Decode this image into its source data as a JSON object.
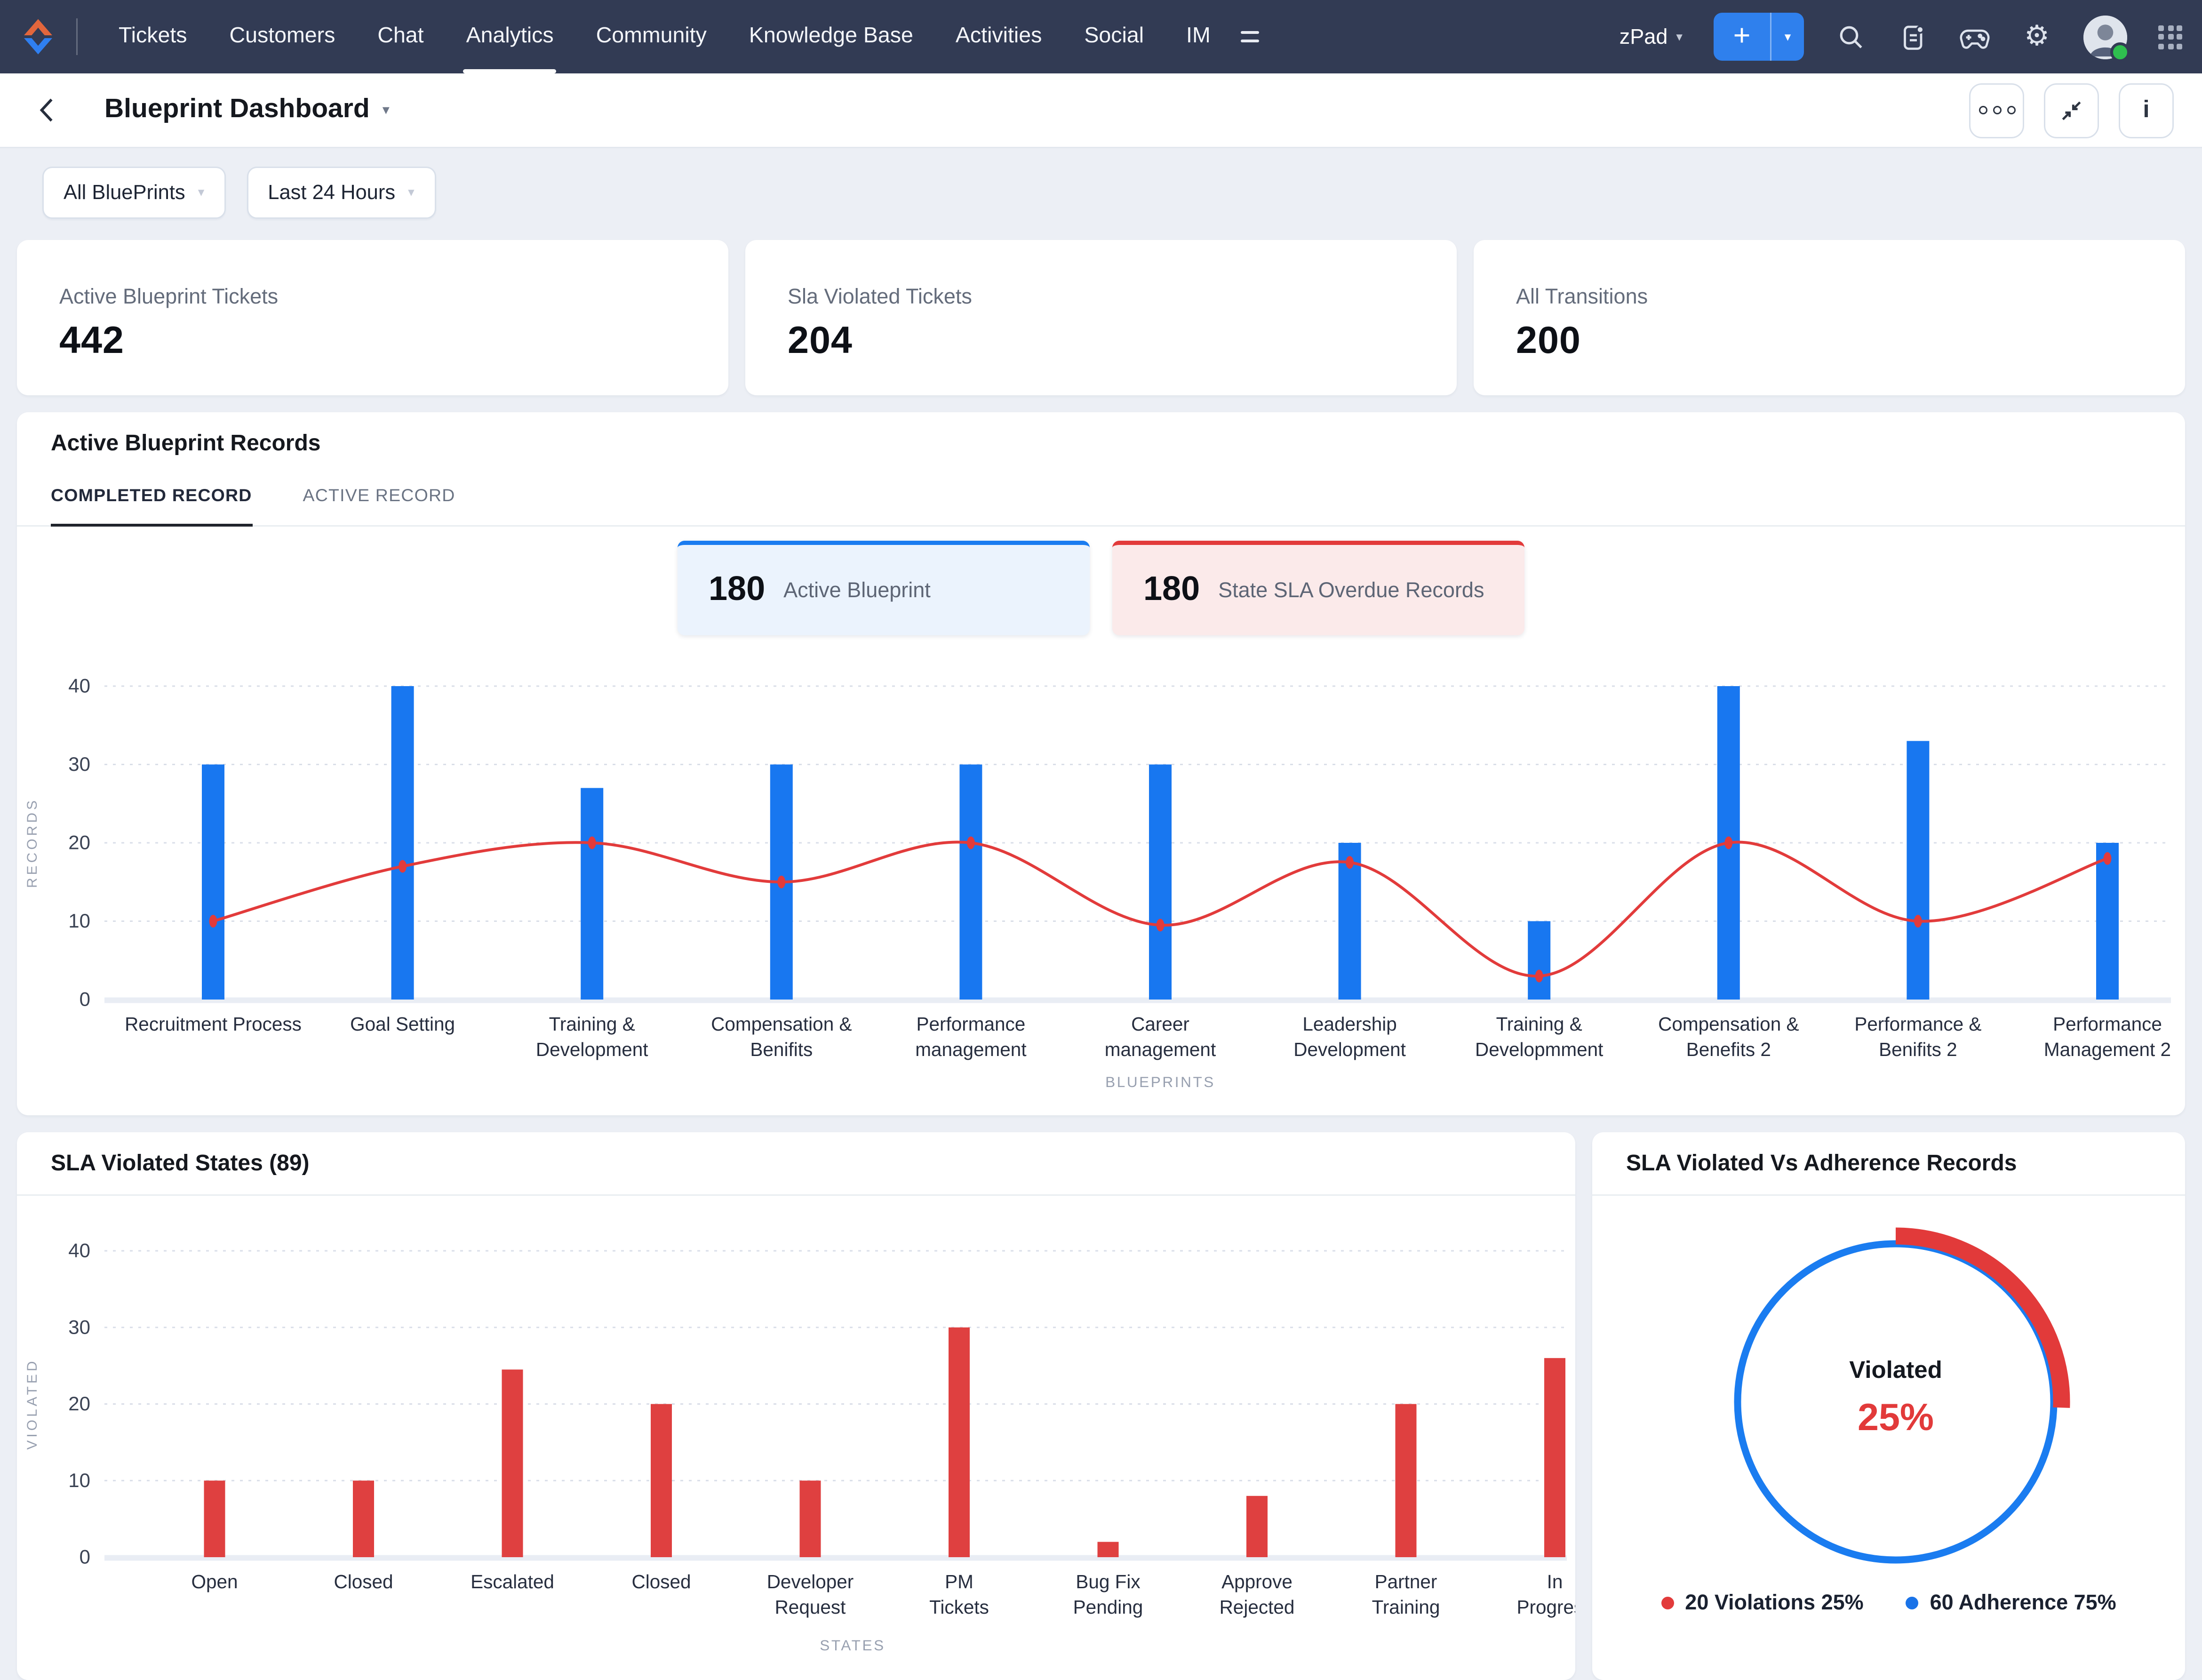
{
  "nav": {
    "menu": [
      "Tickets",
      "Customers",
      "Chat",
      "Analytics",
      "Community",
      "Knowledge Base",
      "Activities",
      "Social",
      "IM"
    ],
    "active_item": "Analytics",
    "department_label": "zPad",
    "add_button": "+",
    "bg_color": "#323b54",
    "accent_blue": "#2f80ed"
  },
  "header": {
    "title": "Blueprint Dashboard"
  },
  "filters": [
    {
      "label": "All BluePrints"
    },
    {
      "label": "Last 24 Hours"
    }
  ],
  "kpis": [
    {
      "label": "Active Blueprint Tickets",
      "value": "442"
    },
    {
      "label": "Sla Violated Tickets",
      "value": "204"
    },
    {
      "label": "All Transitions",
      "value": "200"
    }
  ],
  "records_panel": {
    "title": "Active Blueprint Records",
    "tabs": [
      {
        "label": "COMPLETED RECORD",
        "active": true
      },
      {
        "label": "ACTIVE RECORD",
        "active": false
      }
    ],
    "stats": [
      {
        "value": "180",
        "label": "Active Blueprint",
        "theme": "blue"
      },
      {
        "value": "180",
        "label": "State SLA Overdue Records",
        "theme": "red"
      }
    ]
  },
  "states_panel": {
    "title": "SLA Violated States (89)"
  },
  "donut_panel": {
    "title": "SLA Violated Vs Adherence Records"
  },
  "chart_data": [
    {
      "id": "blueprint-records",
      "type": "bar",
      "title": "Active Blueprint Records",
      "categories": [
        "Recruitment Process",
        "Goal Setting",
        "Training &\nDevelopment",
        "Compensation &\nBenifits",
        "Performance\nmanagement",
        "Career\nmanagement",
        "Leadership\nDevelopment",
        "Training &\nDevelopmment",
        "Compensation &\nBenefits 2",
        "Performance &\nBenifits 2",
        "Performance\nManagement 2"
      ],
      "series": [
        {
          "name": "Active Blueprint",
          "type": "bar",
          "color": "#1877f0",
          "values": [
            30,
            40,
            27,
            30,
            30,
            30,
            20,
            10,
            40,
            33,
            20
          ]
        },
        {
          "name": "State SLA Overdue",
          "type": "line",
          "color": "#e23b3b",
          "values": [
            10,
            17,
            20,
            15,
            20,
            9.5,
            17.5,
            3,
            20,
            10,
            18
          ]
        }
      ],
      "xlabel": "BLUEPRINTS",
      "ylabel": "RECORDS",
      "ylim": [
        0,
        40
      ],
      "yticks": [
        0,
        10,
        20,
        30,
        40
      ],
      "grid": true,
      "legend_position": "none"
    },
    {
      "id": "sla-violated-states",
      "type": "bar",
      "title": "SLA Violated States (89)",
      "categories": [
        "Open",
        "Closed",
        "Escalated",
        "Closed",
        "Developer\nRequest",
        "PM\nTickets",
        "Bug Fix\nPending",
        "Approve\nRejected",
        "Partner\nTraining",
        "In\nProgress"
      ],
      "series": [
        {
          "name": "Violated",
          "type": "bar",
          "color": "#df4040",
          "values": [
            10,
            10,
            24.5,
            20,
            10,
            30,
            2,
            8,
            20,
            26
          ]
        }
      ],
      "xlabel": "STATES",
      "ylabel": "VIOLATED",
      "ylim": [
        0,
        40
      ],
      "yticks": [
        0,
        10,
        20,
        30,
        40
      ],
      "grid": true,
      "legend_position": "none"
    },
    {
      "id": "violated-vs-adherence",
      "type": "pie",
      "title": "SLA Violated Vs Adherence Records",
      "slices": [
        {
          "label": "Violations",
          "count": 20,
          "pct": 25,
          "color": "#e23a3a"
        },
        {
          "label": "Adherence",
          "count": 60,
          "pct": 75,
          "color": "#1a7cf0"
        }
      ],
      "center_label": "Violated",
      "center_value": "25%",
      "legend": [
        {
          "text": "20 Violations 25%",
          "color": "#e23b3b"
        },
        {
          "text": "60 Adherence 75%",
          "color": "#1a73e8"
        }
      ],
      "legend_position": "bottom"
    }
  ]
}
